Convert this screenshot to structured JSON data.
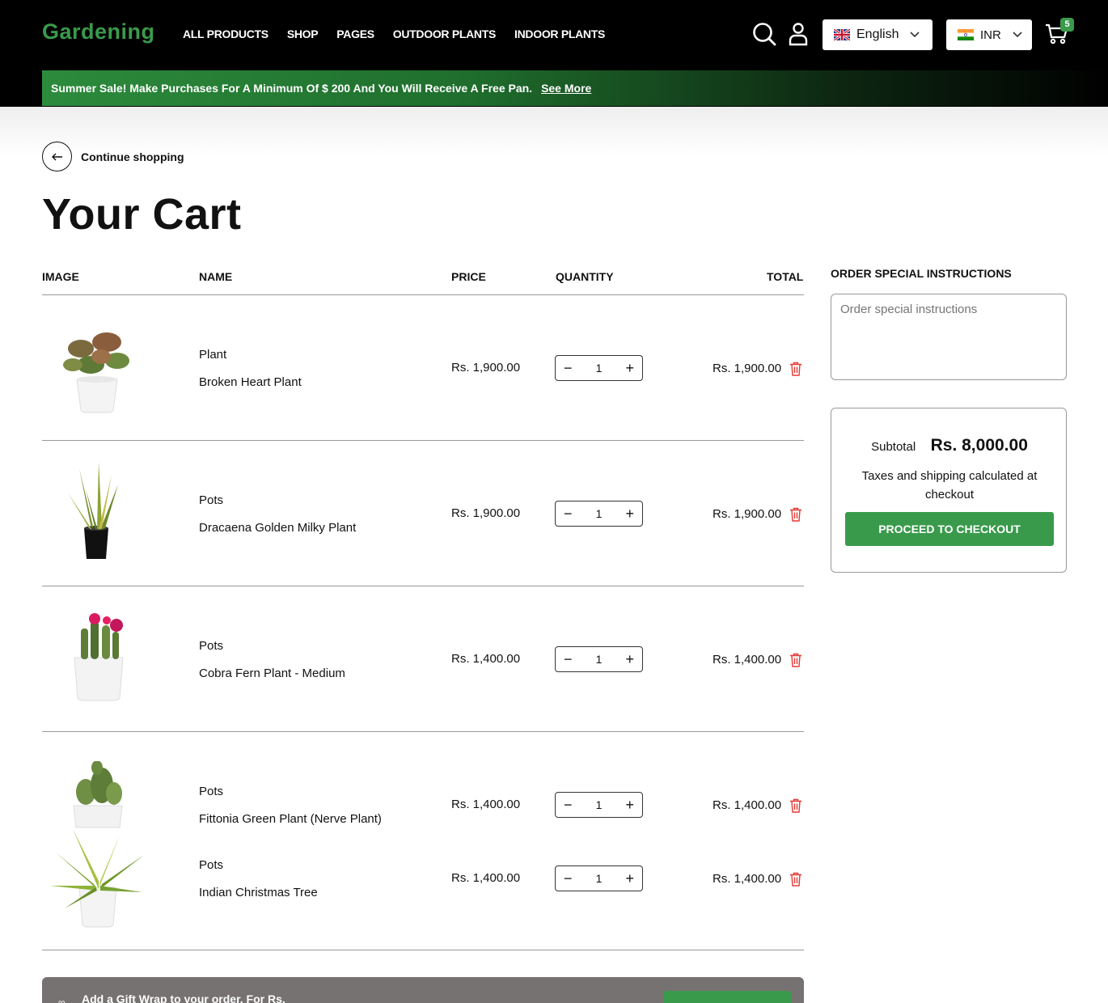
{
  "header": {
    "logo": "Gardening",
    "nav": [
      "ALL PRODUCTS",
      "SHOP",
      "PAGES",
      "OUTDOOR PLANTS",
      "INDOOR PLANTS"
    ],
    "language": "English",
    "currency": "INR",
    "cart_count": "5"
  },
  "promo": {
    "text": "Summer Sale! Make Purchases For A Minimum Of $ 200 And You Will Receive A Free Pan.",
    "link": "See More"
  },
  "back_label": "Continue shopping",
  "page_title": "Your Cart",
  "table": {
    "headers": {
      "image": "IMAGE",
      "name": "NAME",
      "price": "PRICE",
      "quantity": "QUANTITY",
      "total": "TOTAL"
    },
    "items": [
      {
        "category": "Plant",
        "name": "Broken Heart Plant",
        "price": "Rs. 1,900.00",
        "qty": "1",
        "total": "Rs. 1,900.00"
      },
      {
        "category": "Pots",
        "name": "Dracaena Golden Milky Plant",
        "price": "Rs. 1,900.00",
        "qty": "1",
        "total": "Rs. 1,900.00"
      },
      {
        "category": "Pots",
        "name": "Cobra Fern Plant - Medium",
        "price": "Rs. 1,400.00",
        "qty": "1",
        "total": "Rs. 1,400.00"
      },
      {
        "category": "Pots",
        "name": "Fittonia Green Plant (Nerve Plant)",
        "price": "Rs. 1,400.00",
        "qty": "1",
        "total": "Rs. 1,400.00"
      },
      {
        "category": "Pots",
        "name": "Indian Christmas Tree",
        "price": "Rs. 1,400.00",
        "qty": "1",
        "total": "Rs. 1,400.00"
      }
    ]
  },
  "sidebar": {
    "instructions_label": "ORDER SPECIAL INSTRUCTIONS",
    "instructions_placeholder": "Order special instructions",
    "subtotal_label": "Subtotal",
    "subtotal_value": "Rs. 8,000.00",
    "tax_note": "Taxes and shipping calculated at checkout",
    "checkout_label": "PROCEED TO CHECKOUT"
  },
  "gift": {
    "text": "Add a Gift Wrap to your order. For Rs."
  },
  "colors": {
    "accent": "#3a9a4c",
    "header_bg": "#000000",
    "delete": "#e53935"
  }
}
